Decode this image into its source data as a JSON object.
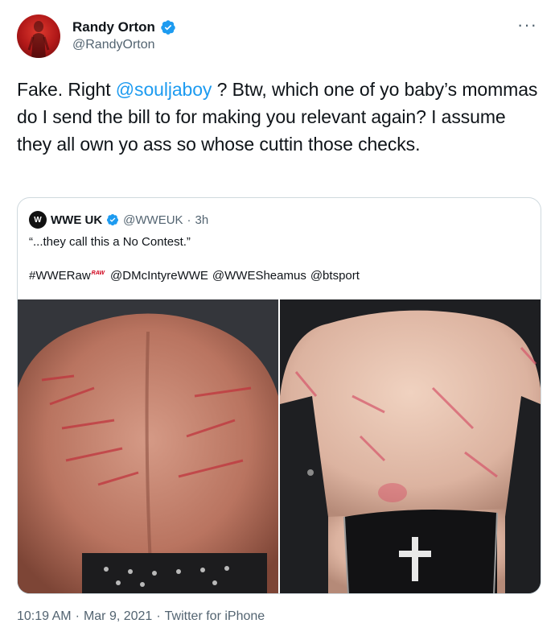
{
  "author": {
    "display_name": "Randy Orton",
    "handle": "@RandyOrton",
    "verified": true,
    "more_icon": "more-horizontal-icon"
  },
  "tweet": {
    "text_before": "Fake. Right ",
    "mention": "@souljaboy",
    "text_after": " ? Btw, which one of yo baby’s mommas do I send the bill to for making you relevant again? I assume they all own yo ass so whose cuttin those checks."
  },
  "quoted_tweet": {
    "display_name": "WWE UK",
    "avatar_text": "W",
    "handle": "@WWEUK",
    "separator": "·",
    "time": "3h",
    "line1": "“...they call this a No Contest.”",
    "hashtag": "#WWERaw",
    "raw_badge": "RAW",
    "mentions": [
      "@DMcIntyreWWE",
      "@WWESheamus",
      "@btsport"
    ]
  },
  "footer": {
    "time": "10:19 AM",
    "sep1": "·",
    "date": "Mar 9, 2021",
    "sep2": "·",
    "source": "Twitter for iPhone"
  },
  "colors": {
    "link": "#1d9bf0",
    "secondary_text": "#536471",
    "border": "#cfd9de",
    "verified": "#1d9bf0"
  }
}
